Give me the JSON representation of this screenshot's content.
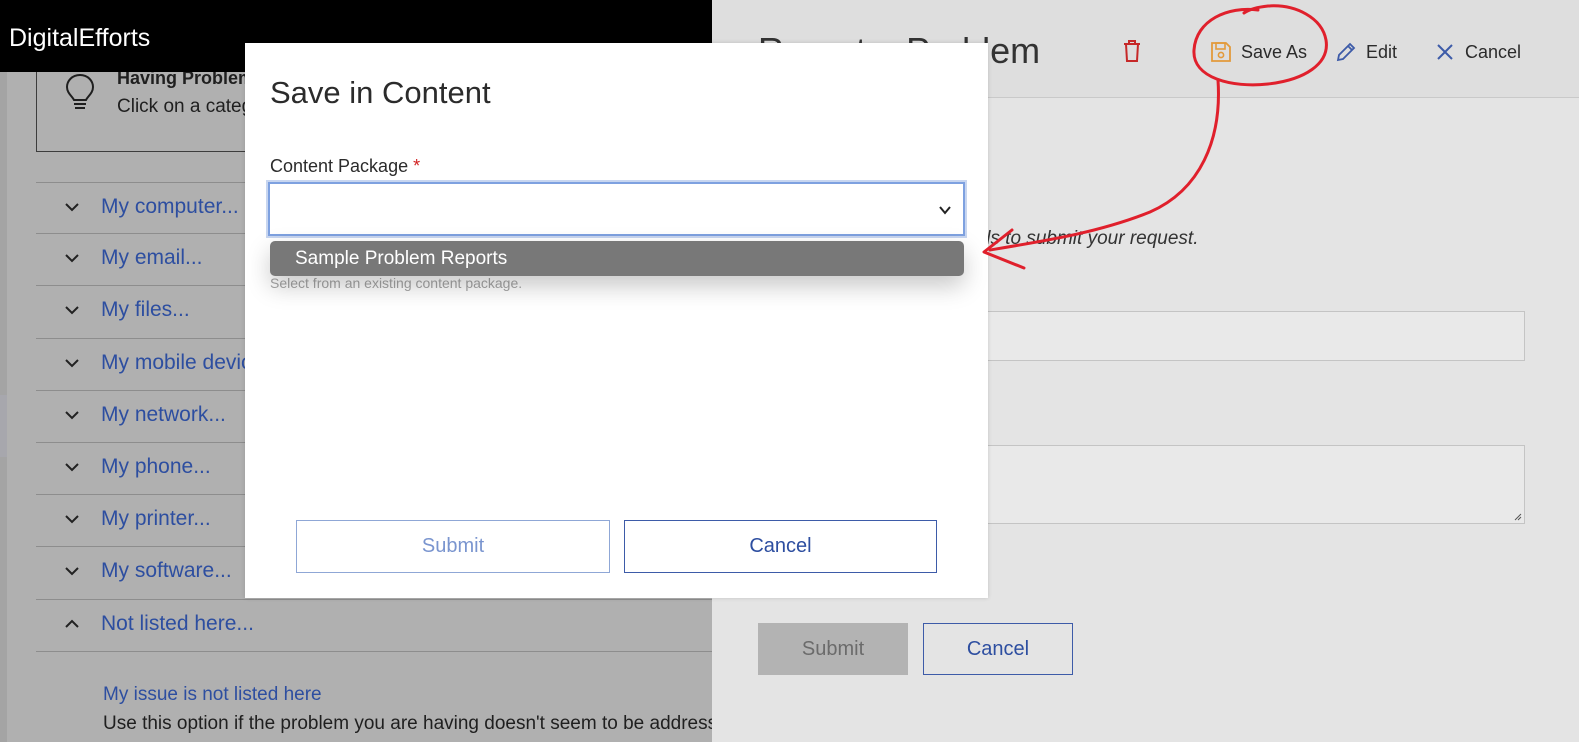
{
  "app": {
    "title": "DigitalEfforts"
  },
  "tip": {
    "title": "Having Problems?",
    "text": "Click on a category below"
  },
  "categories": [
    {
      "label": "My computer...",
      "expanded": false
    },
    {
      "label": "My email...",
      "expanded": false
    },
    {
      "label": "My files...",
      "expanded": false
    },
    {
      "label": "My mobile device...",
      "expanded": false
    },
    {
      "label": "My network...",
      "expanded": false
    },
    {
      "label": "My phone...",
      "expanded": false
    },
    {
      "label": "My printer...",
      "expanded": false
    },
    {
      "label": "My software...",
      "expanded": false
    },
    {
      "label": "Not listed here...",
      "expanded": true
    }
  ],
  "issue": {
    "link": "My issue is not listed here",
    "description": "Use this option if the problem you are having doesn't seem to be addressed"
  },
  "panel": {
    "title": "Report a Problem",
    "toolbar": {
      "save_as": "Save As",
      "edit": "Edit",
      "cancel": "Cancel"
    },
    "instruction": "ils to submit your request.",
    "submit": "Submit",
    "cancel": "Cancel"
  },
  "modal": {
    "title": "Save in Content",
    "field_label": "Content Package",
    "required_mark": "*",
    "selected_value": "",
    "dropdown_option": "Sample Problem Reports",
    "hint": "Select from an existing content package.",
    "submit": "Submit",
    "cancel": "Cancel"
  },
  "colors": {
    "link_blue": "#2d4ea0",
    "annotation_red": "#e0202c",
    "required_red": "#d12020",
    "toolbar_delete_red": "#c62828",
    "toolbar_save_orange": "#e39a3b",
    "toolbar_blue": "#3d5ba8"
  }
}
